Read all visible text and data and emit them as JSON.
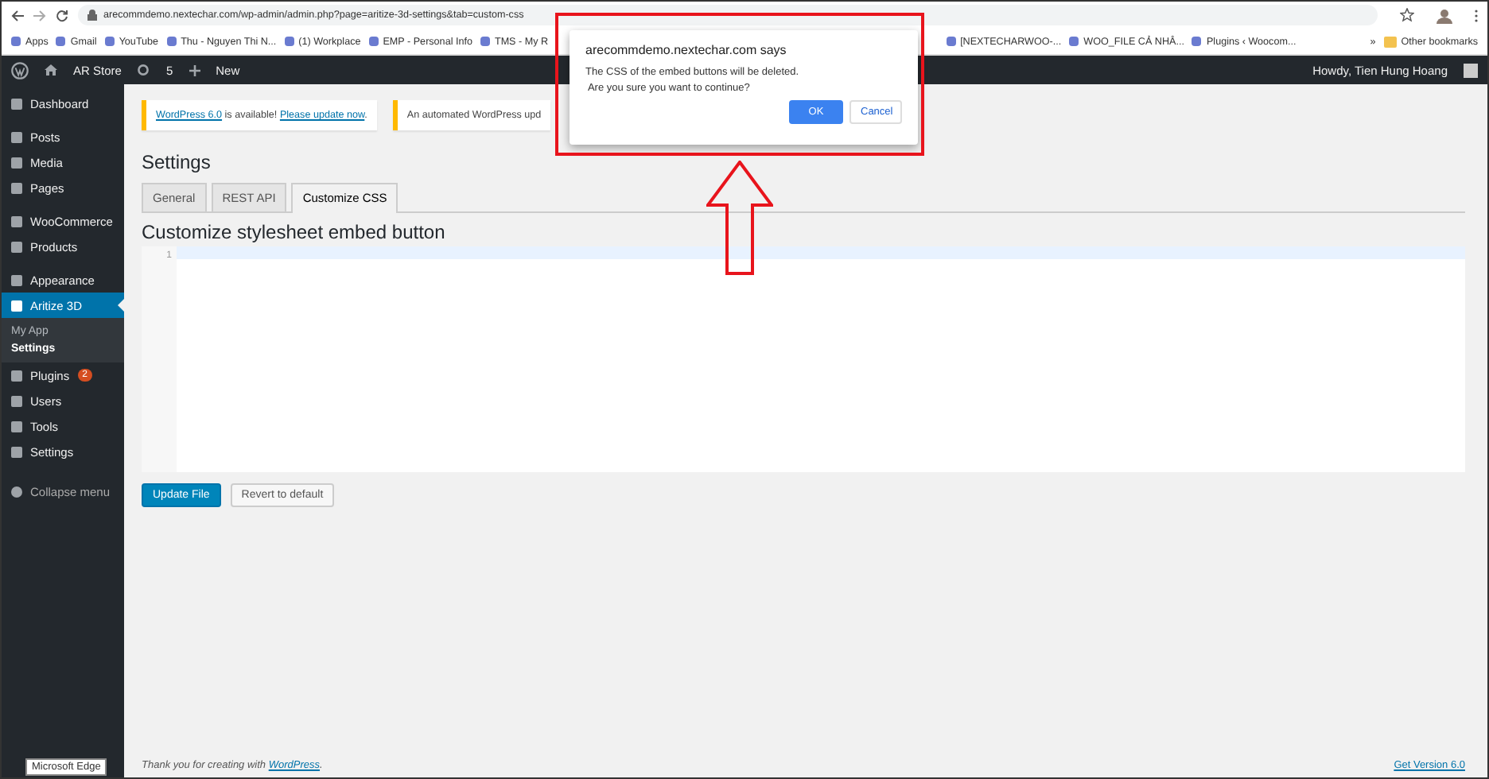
{
  "browser": {
    "address": "arecommdemo.nextechar.com/wp-admin/admin.php?page=aritize-3d-settings&tab=custom-css",
    "bookmarks": [
      {
        "label": "Apps"
      },
      {
        "label": "Gmail"
      },
      {
        "label": "YouTube"
      },
      {
        "label": "Thu - Nguyen Thi N..."
      },
      {
        "label": "(1) Workplace"
      },
      {
        "label": "EMP - Personal Info"
      },
      {
        "label": "TMS - My R"
      }
    ],
    "bookmarks_right": [
      {
        "label": "[NEXTECHARWOO-..."
      },
      {
        "label": "WOO_FILE CẢ NHÂ..."
      },
      {
        "label": "Plugins ‹ Woocom..."
      }
    ],
    "more": "»",
    "other_bookmarks": "Other bookmarks"
  },
  "admin_bar": {
    "site": "AR Store",
    "updates": "5",
    "new": "New",
    "howdy": "Howdy, Tien Hung Hoang"
  },
  "sidebar": {
    "groups": [
      [
        {
          "label": "Dashboard",
          "selected": false
        }
      ],
      [
        {
          "label": "Posts",
          "selected": false
        },
        {
          "label": "Media",
          "selected": false
        },
        {
          "label": "Pages",
          "selected": false
        }
      ],
      [
        {
          "label": "WooCommerce",
          "selected": false
        },
        {
          "label": "Products",
          "selected": false
        }
      ],
      [
        {
          "label": "Appearance",
          "selected": false
        },
        {
          "label": "Aritize 3D",
          "selected": true,
          "children": [
            {
              "label": "My App",
              "selected": false
            },
            {
              "label": "Settings",
              "selected": true
            }
          ]
        },
        {
          "label": "Plugins",
          "selected": false,
          "badge": "2"
        },
        {
          "label": "Users",
          "selected": false
        },
        {
          "label": "Tools",
          "selected": false
        },
        {
          "label": "Settings",
          "selected": false
        }
      ]
    ],
    "collapse": "Collapse menu"
  },
  "notices": [
    {
      "parts": [
        {
          "text": "WordPress 6.0",
          "link": true
        },
        {
          "text": " is available! ",
          "link": false
        },
        {
          "text": "Please update now",
          "link": true
        },
        {
          "text": ".",
          "link": false
        }
      ]
    },
    {
      "parts": [
        {
          "text": "An automated WordPress upd",
          "link": false
        }
      ]
    }
  ],
  "page": {
    "title": "Settings",
    "tabs": [
      {
        "label": "General",
        "selected": false
      },
      {
        "label": "REST API",
        "selected": false
      },
      {
        "label": "Customize CSS",
        "selected": true
      }
    ],
    "heading": "Customize stylesheet embed button",
    "editor": {
      "line_numbers": [
        "1"
      ]
    },
    "buttons": [
      {
        "label": "Update File",
        "primary": true
      },
      {
        "label": "Revert to default",
        "primary": false
      }
    ]
  },
  "footer": {
    "parts": [
      {
        "text": "Thank you for creating with ",
        "link": false
      },
      {
        "text": "WordPress",
        "link": true
      },
      {
        "text": ".",
        "link": false
      }
    ],
    "version": "Get Version 6.0"
  },
  "tooltip": "Microsoft Edge",
  "dialog": {
    "title": "arecommdemo.nextechar.com says",
    "lines": [
      "The CSS of the embed buttons will be deleted.",
      " Are you sure you want to continue?"
    ],
    "ok": "OK",
    "cancel": "Cancel"
  }
}
